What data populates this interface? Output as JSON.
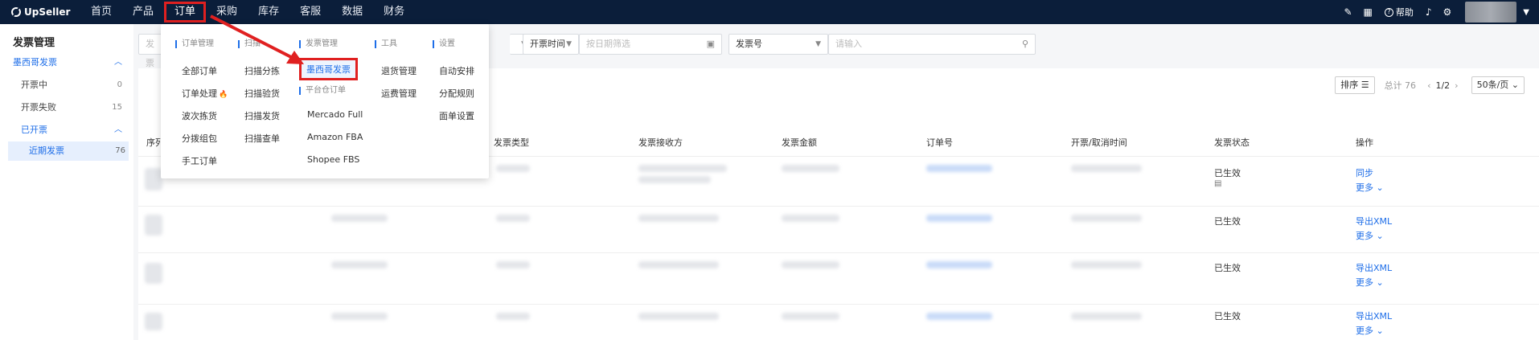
{
  "topbar": {
    "logo": "UpSeller",
    "nav": [
      "首页",
      "产品",
      "订单",
      "采购",
      "库存",
      "客服",
      "数据",
      "财务"
    ],
    "active_index": 2,
    "help_label": "帮助"
  },
  "sidebar": {
    "title": "发票管理",
    "group": "墨西哥发票",
    "items": [
      {
        "label": "开票中",
        "count": "0"
      },
      {
        "label": "开票失败",
        "count": "15"
      }
    ],
    "subgroup": "已开票",
    "selected": {
      "label": "近期发票",
      "count": "76"
    }
  },
  "filters": {
    "first_placeholder": "发票",
    "date_type": "开票时间",
    "date_placeholder": "按日期筛选",
    "field_type": "发票号",
    "field_placeholder": "请输入"
  },
  "toolbar": {
    "sort_label": "排序",
    "total_label": "总计 76",
    "page": "1/2",
    "per_page": "50条/页"
  },
  "table": {
    "columns": [
      "序列",
      "发票类型",
      "发票接收方",
      "发票金额",
      "订单号",
      "开票/取消时间",
      "发票状态",
      "操作"
    ],
    "rows": [
      {
        "status": "已生效",
        "op": "同步",
        "more": "更多"
      },
      {
        "status": "已生效",
        "op": "导出XML",
        "more": "更多"
      },
      {
        "status": "已生效",
        "op": "导出XML",
        "more": "更多"
      },
      {
        "status": "已生效",
        "op": "导出XML",
        "more": "更多"
      }
    ]
  },
  "dropdown": {
    "col1": {
      "head": "订单管理",
      "items": [
        "全部订单",
        "订单处理",
        "波次拣货",
        "分拨组包",
        "手工订单"
      ]
    },
    "col2": {
      "head": "扫描",
      "items": [
        "扫描分拣",
        "扫描验货",
        "扫描发货",
        "扫描查单"
      ]
    },
    "col3": {
      "head": "发票管理",
      "items": [
        "墨西哥发票"
      ],
      "head2": "平台仓订单",
      "items2": [
        "Mercado Full",
        "Amazon FBA",
        "Shopee FBS"
      ]
    },
    "col4": {
      "head": "工具",
      "items": [
        "退货管理",
        "运费管理"
      ]
    },
    "col5": {
      "head": "设置",
      "items": [
        "自动安排",
        "分配规则",
        "面单设置"
      ]
    }
  },
  "colors": {
    "nav_bg": "#0b1e3a",
    "accent": "#1e6ee8",
    "highlight": "#e02020"
  }
}
